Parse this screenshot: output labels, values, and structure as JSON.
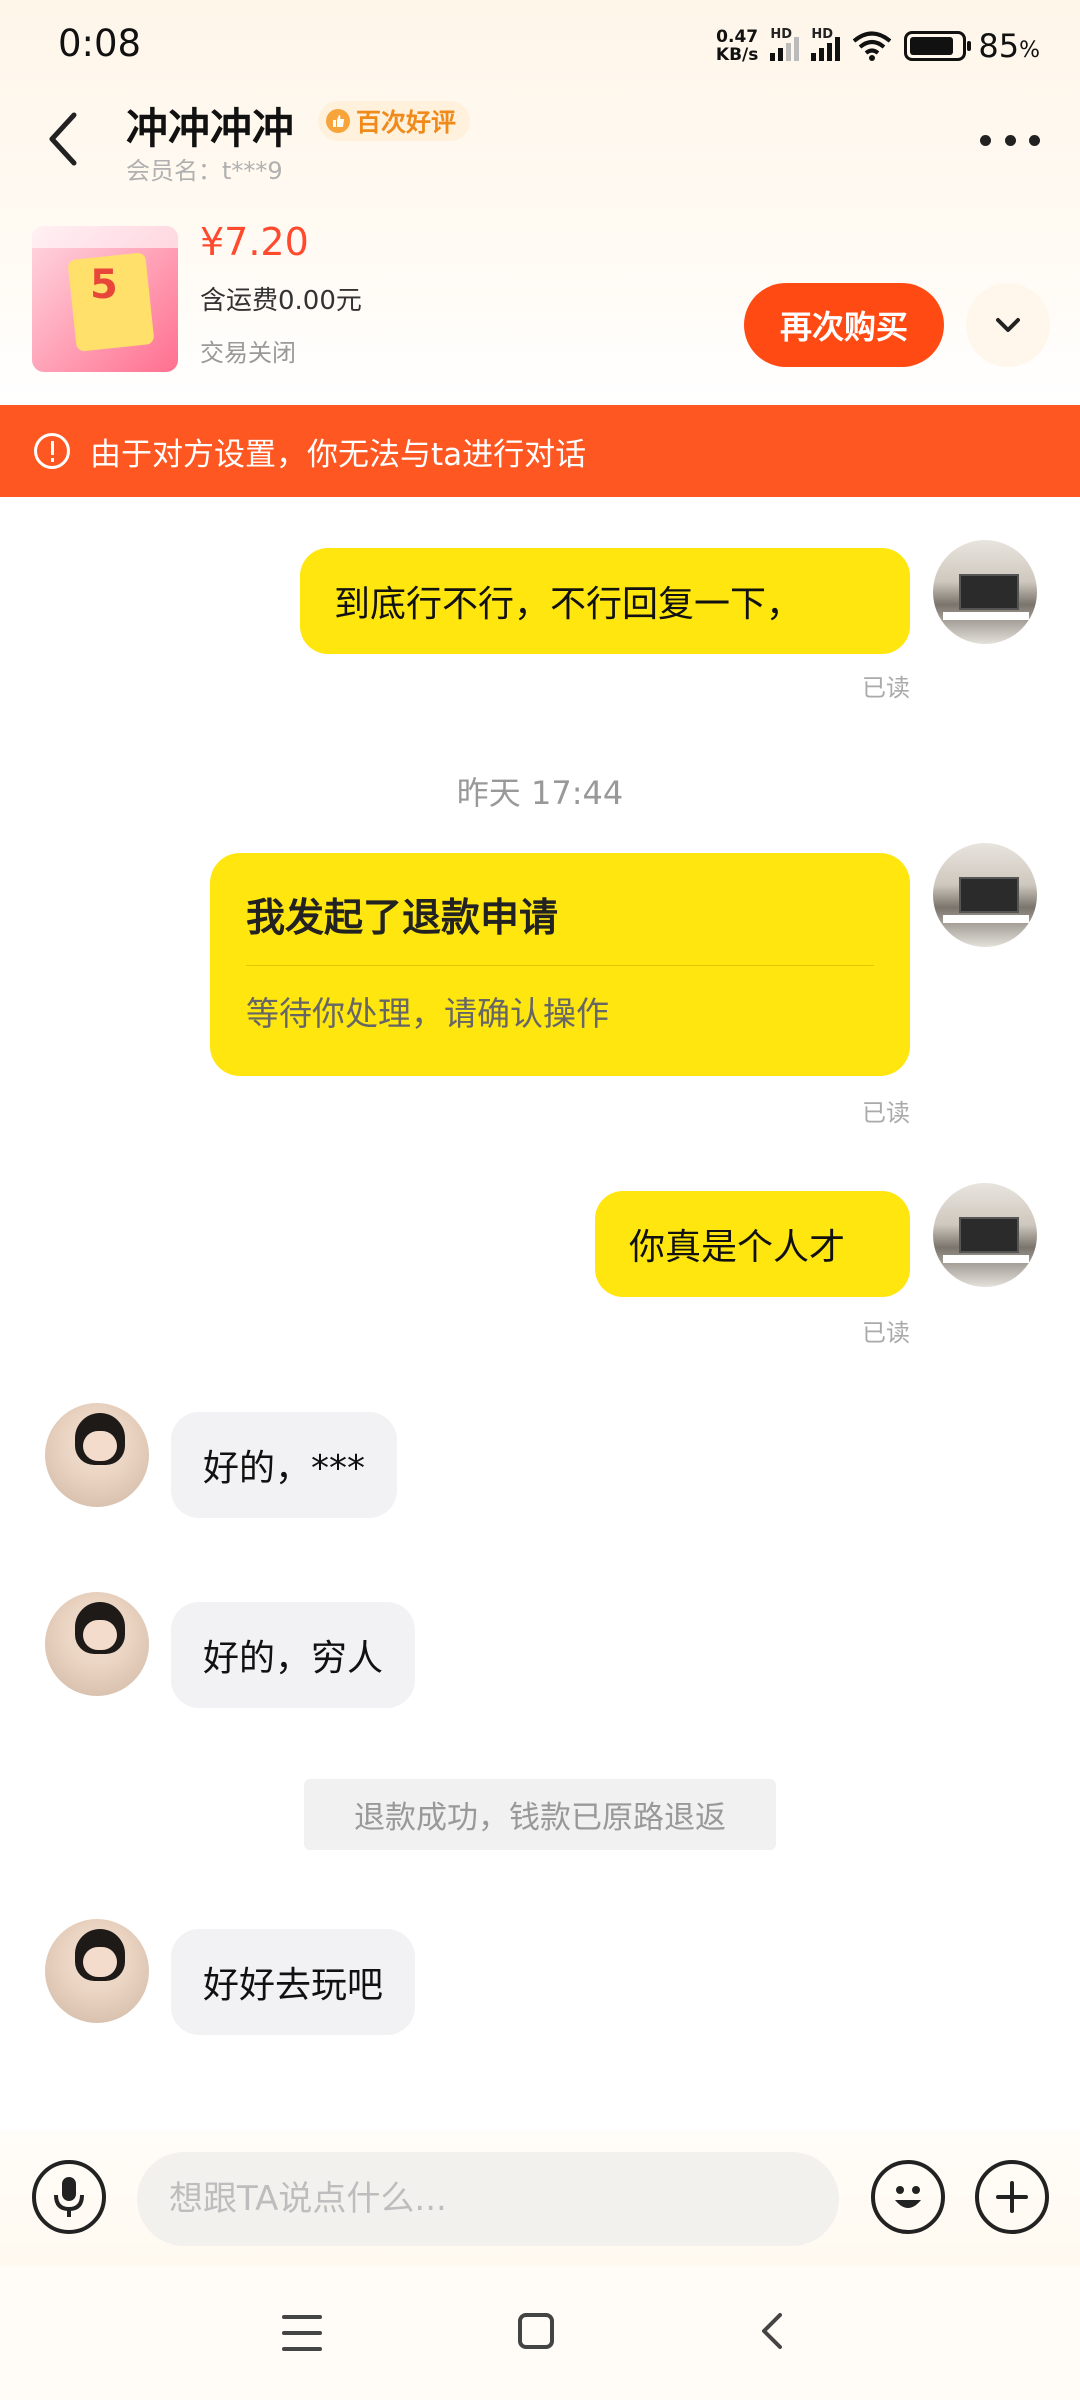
{
  "status_bar": {
    "time": "0:08",
    "speed_value": "0.47",
    "speed_unit": "KB/s",
    "hd_label": "HD",
    "battery": "85",
    "battery_unit": "%"
  },
  "header": {
    "title": "冲冲冲冲",
    "badge": "百次好评",
    "member": "会员名：t***9"
  },
  "product": {
    "price": "¥7.20",
    "shipping": "含运费0.00元",
    "status": "交易关闭",
    "rebuy_label": "再次购买",
    "thumb_text": "5"
  },
  "banner": {
    "text": "由于对方设置，你无法与ta进行对话"
  },
  "chat": {
    "msg1": "到底行不行，不行回复一下，",
    "read_label": "已读",
    "time_separator": "昨天 17:44",
    "refund_title": "我发起了退款申请",
    "refund_sub": "等待你处理，请确认操作",
    "msg3": "你真是个人才",
    "reply1": "好的，***",
    "reply2": "好的，穷人",
    "system_msg": "退款成功，钱款已原路退返",
    "reply3": "好好去玩吧"
  },
  "input": {
    "placeholder": "想跟TA说点什么..."
  },
  "colors": {
    "accent_orange": "#ff4a14",
    "bubble_yellow": "#ffe60f",
    "banner_red": "#ff5722",
    "price_red": "#ff4a2e"
  }
}
